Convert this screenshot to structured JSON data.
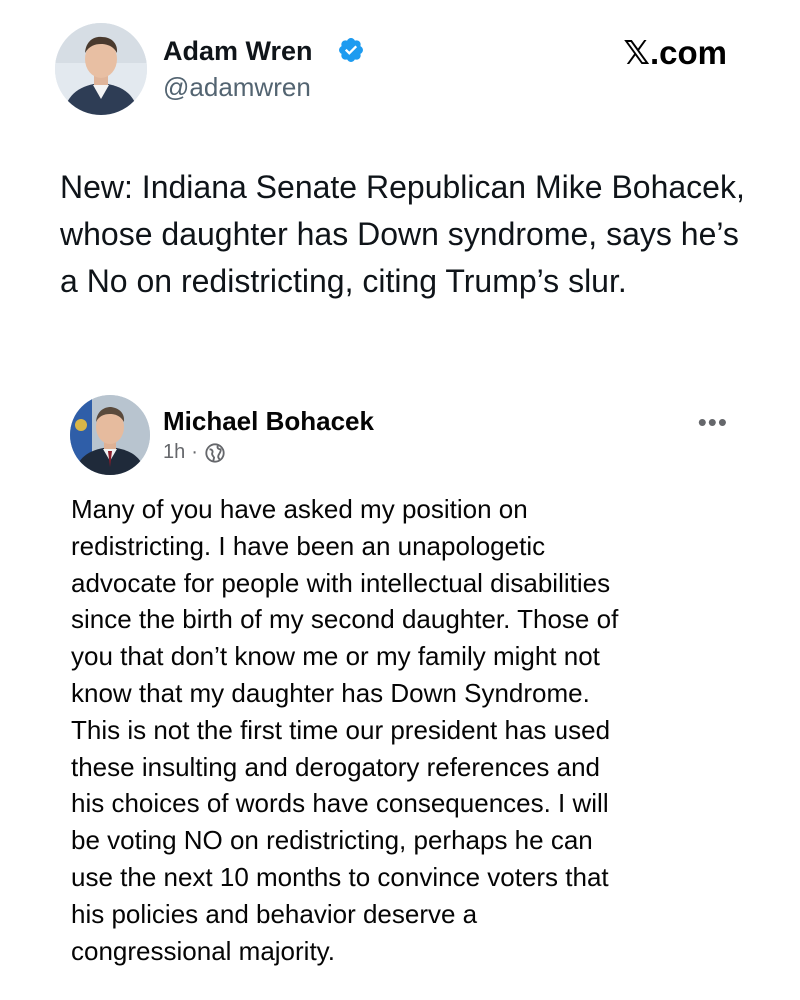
{
  "tweet": {
    "author": {
      "name": "Adam Wren",
      "handle": "@adamwren",
      "verified": true
    },
    "brand": "𝕏.com",
    "text": "New: Indiana Senate Republican Mike Bohacek, whose daughter has Down syndrome, says he’s a No on redistricting, citing Trump’s slur."
  },
  "quoted_post": {
    "author": "Michael Bohacek",
    "time": "1h",
    "separator": "·",
    "audience_icon": "globe-icon",
    "more_icon": "more-horizontal-icon",
    "lines": [
      "Many of you have asked my position on",
      "redistricting.  I have been an unapologetic",
      "advocate for people with intellectual disabilities",
      "since the birth of my second daughter.  Those of",
      "you that don’t know me or my family might not",
      "know that my daughter has Down Syndrome.",
      "This is not the first time our president has used",
      "these insulting and derogatory references and",
      "his choices of words have consequences.  I will",
      "be voting NO on redistricting, perhaps he can",
      "use the next 10 months to convince voters that",
      "his policies and behavior deserve a",
      "congressional majority."
    ]
  },
  "colors": {
    "verified_badge": "#1d9bf0",
    "primary_text": "#0f1419",
    "secondary_text": "#536471",
    "meta_text": "#65676b"
  }
}
